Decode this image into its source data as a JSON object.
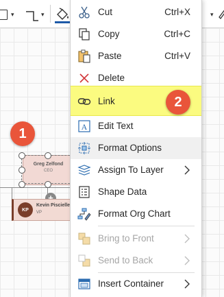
{
  "canvas": {
    "ceo": {
      "name": "Greg Zelfond",
      "title": "CEO"
    },
    "vp": {
      "initials": "KP",
      "name": "Kevin Piscielle",
      "title": "VP"
    },
    "add_symbol": "+"
  },
  "callouts": {
    "first": "1",
    "second": "2"
  },
  "context_menu": {
    "items": [
      {
        "label": "Cut",
        "shortcut": "Ctrl+X",
        "icon": "scissors-icon"
      },
      {
        "label": "Copy",
        "shortcut": "Ctrl+C",
        "icon": "copy-icon"
      },
      {
        "label": "Paste",
        "shortcut": "Ctrl+V",
        "icon": "paste-icon"
      },
      {
        "label": "Delete",
        "icon": "delete-x-icon"
      },
      {
        "label": "Link",
        "icon": "link-icon",
        "highlighted": true
      },
      {
        "label": "Edit Text",
        "icon": "edit-text-icon"
      },
      {
        "label": "Format Options",
        "icon": "format-options-icon",
        "hovered": true
      },
      {
        "label": "Assign To Layer",
        "icon": "layers-icon",
        "submenu": true
      },
      {
        "label": "Shape Data",
        "icon": "shape-data-icon"
      },
      {
        "label": "Format Org Chart",
        "icon": "org-chart-icon"
      },
      {
        "label": "Bring to Front",
        "icon": "bring-to-front-icon",
        "submenu": true,
        "disabled": true
      },
      {
        "label": "Send to Back",
        "icon": "send-to-back-icon",
        "submenu": true,
        "disabled": true
      },
      {
        "label": "Insert Container",
        "icon": "container-icon",
        "submenu": true
      }
    ]
  },
  "colors": {
    "highlight": "#fbfb80",
    "callout": "#e9553a",
    "ceo_card": "#f2d9d4",
    "avatar": "#7a3e2a",
    "toolbar_accent": "#1e5aa8"
  }
}
